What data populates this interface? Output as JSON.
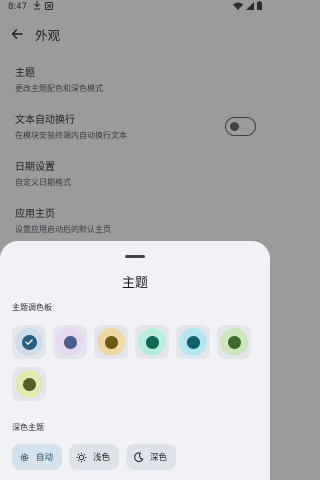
{
  "status_bar": {
    "time": "8:47"
  },
  "app_bar": {
    "title": "外观"
  },
  "settings": [
    {
      "title": "主题",
      "subtitle": "更改主题配色和深色模式"
    },
    {
      "title": "文本自动换行",
      "subtitle": "在模块安装终端内自动换行文本",
      "toggle_on": false
    },
    {
      "title": "日期设置",
      "subtitle": "自定义日期格式"
    },
    {
      "title": "应用主页",
      "subtitle": "设置应用启动后的默认主页"
    }
  ],
  "sheet": {
    "title": "主题",
    "palette_label": "主题调色板",
    "swatches": [
      {
        "ring": "#cfdde9",
        "dot": "#2a5d82",
        "selected": true
      },
      {
        "ring": "#e6d8ee",
        "dot": "#4b5e8e",
        "selected": false
      },
      {
        "ring": "#eed8a6",
        "dot": "#6d5a12",
        "selected": false
      },
      {
        "ring": "#b8ecdd",
        "dot": "#0f6a55",
        "selected": false
      },
      {
        "ring": "#b6e6ee",
        "dot": "#0d6470",
        "selected": false
      },
      {
        "ring": "#cfe6bd",
        "dot": "#3d6b2c",
        "selected": false
      },
      {
        "ring": "#e2e9b5",
        "dot": "#556026",
        "selected": false
      }
    ],
    "dark_label": "深色主题",
    "dark_options": [
      {
        "label": "自动",
        "icon": "settings-gear-icon",
        "active": true
      },
      {
        "label": "浅色",
        "icon": "sun-icon",
        "active": false
      },
      {
        "label": "深色",
        "icon": "moon-icon",
        "active": false
      }
    ]
  }
}
